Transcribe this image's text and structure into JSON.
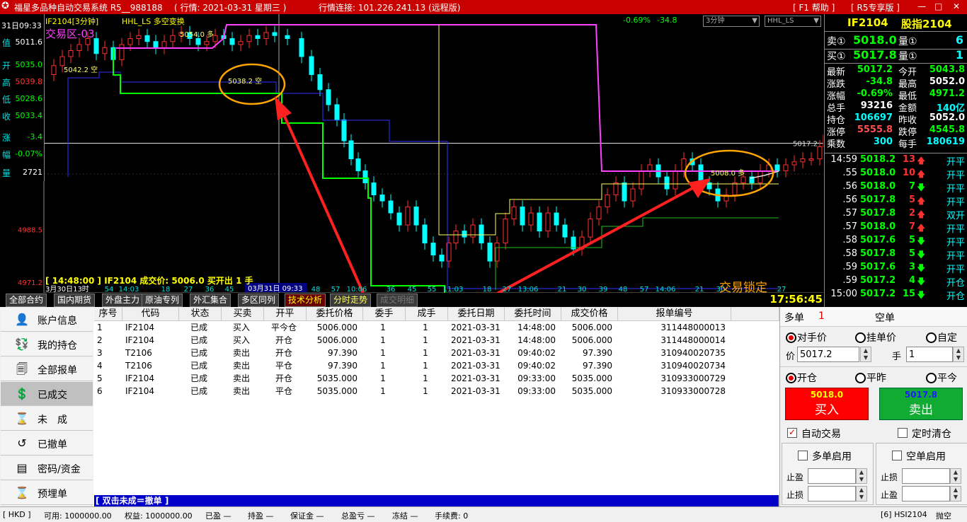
{
  "title_bar": {
    "app_title": "福星多品种自动交易系统 R5__988188",
    "market_info": "( 行情: 2021-03-31 星期三 )",
    "connection": "行情连接: 101.226.241.13 (远程版)",
    "help": "[ F1 帮助 ]",
    "edition": "[ R5专享版 ]"
  },
  "chart": {
    "header": "IF2104[3分钟]",
    "indicator": "HHL_LS 多空变换",
    "zone": "交易区-03",
    "change_pct": "-0.69%",
    "change_abs": "-34.8",
    "period_select": "3分钟",
    "indicator_select": "HHL_LS",
    "trade_info": "[ 14:48:00 ] IF2104 成交价: 5006.0 买开出 1 手",
    "lock_label": "交易锁定",
    "clock": "17:56:45",
    "price_labels": [
      "4988.5",
      "4971.2"
    ],
    "annotations": [
      "5054.0 多",
      "5042.2 空",
      "5038.2 空",
      "5008.0 多"
    ],
    "last_price_label": "5017.2",
    "x_start": "3月30日13时",
    "date_marker": "03月31日 09:33",
    "x_ticks": [
      "54",
      "14:03",
      "18",
      "27",
      "36",
      "45",
      "48",
      "57",
      "10:06",
      "36",
      "45",
      "55",
      "11:03",
      "18",
      "27",
      "13:06",
      "21",
      "30",
      "39",
      "48",
      "57",
      "14:06",
      "21",
      "30",
      "27"
    ],
    "colors": {
      "up": "#ff3030",
      "down": "#00ffff",
      "short_line": "#00ff00",
      "long_line": "#ff40ff",
      "highlight": "#ffa500",
      "arrow": "#ff2020"
    }
  },
  "left_info": {
    "date": "31日09:33",
    "rows": [
      {
        "k": "值",
        "v": "5011.6",
        "color": "#ffffff"
      },
      {
        "k": "开",
        "v": "5035.0",
        "color": "#00ff00"
      },
      {
        "k": "高",
        "v": "5039.8",
        "color": "#ff3030"
      },
      {
        "k": "低",
        "v": "5028.6",
        "color": "#00ff00"
      },
      {
        "k": "收",
        "v": "5033.4",
        "color": "#00ff00"
      },
      {
        "k": "涨",
        "v": "-3.4",
        "color": "#00ff00"
      },
      {
        "k": "幅",
        "v": "-0.07%",
        "color": "#00ff00"
      },
      {
        "k": "量",
        "v": "2721",
        "color": "#ffffff"
      }
    ]
  },
  "chart_tabs": [
    "全部合约",
    "国内期货",
    "外盘主力",
    "原油专列",
    "外汇集合",
    "多区同列",
    "技术分析",
    "分时走势",
    "成交明细"
  ],
  "quote": {
    "symbol": "IF2104",
    "name": "股指2104",
    "sell": {
      "label": "卖①",
      "price": "5018.0",
      "vol_label": "量①",
      "vol": "6"
    },
    "buy": {
      "label": "买①",
      "price": "5017.8",
      "vol_label": "量①",
      "vol": "1"
    },
    "stats": [
      [
        "最新",
        "5017.2",
        "今开",
        "5043.8"
      ],
      [
        "涨跌",
        "-34.8",
        "最高",
        "5052.0"
      ],
      [
        "涨幅",
        "-0.69%",
        "最低",
        "4971.2"
      ],
      [
        "总手",
        "93216",
        "金额",
        "140亿"
      ],
      [
        "持仓",
        "106697",
        "昨收",
        "5052.0"
      ],
      [
        "涨停",
        "5555.8",
        "跌停",
        "4545.8"
      ],
      [
        "乘数",
        "300",
        "每手",
        "180619"
      ]
    ],
    "ticks": [
      {
        "time": "14:59",
        "price": "5018.2",
        "vol": "13",
        "dir": "up",
        "type": "开平"
      },
      {
        "time": ".55",
        "price": "5018.0",
        "vol": "10",
        "dir": "up",
        "type": "开平"
      },
      {
        "time": ".56",
        "price": "5018.0",
        "vol": "7",
        "dir": "down",
        "type": "开平"
      },
      {
        "time": ".56",
        "price": "5017.8",
        "vol": "5",
        "dir": "up",
        "type": "开平"
      },
      {
        "time": ".57",
        "price": "5017.8",
        "vol": "2",
        "dir": "up",
        "type": "双开"
      },
      {
        "time": ".57",
        "price": "5018.0",
        "vol": "7",
        "dir": "up",
        "type": "开平"
      },
      {
        "time": ".58",
        "price": "5017.6",
        "vol": "5",
        "dir": "down",
        "type": "开平"
      },
      {
        "time": ".58",
        "price": "5017.8",
        "vol": "5",
        "dir": "down",
        "type": "开平"
      },
      {
        "time": ".59",
        "price": "5017.6",
        "vol": "3",
        "dir": "down",
        "type": "开平"
      },
      {
        "time": ".59",
        "price": "5017.2",
        "vol": "4",
        "dir": "down",
        "type": "开仓"
      },
      {
        "time": "15:00",
        "price": "5017.2",
        "vol": "15",
        "dir": "down",
        "type": "开仓"
      }
    ]
  },
  "sidebar": [
    {
      "label": "账户信息",
      "icon": "👤"
    },
    {
      "label": "我的持仓",
      "icon": "💱"
    },
    {
      "label": "全部报单",
      "icon": "🗐"
    },
    {
      "label": "已成交",
      "icon": "💲"
    },
    {
      "label": "未　成",
      "icon": "⌛"
    },
    {
      "label": "已撤单",
      "icon": "↺"
    },
    {
      "label": "密码/资金",
      "icon": "▤"
    },
    {
      "label": "预埋单",
      "icon": "⌛"
    }
  ],
  "table": {
    "headers": [
      "序号",
      "代码",
      "状态",
      "买卖",
      "开平",
      "委托价格",
      "委手",
      "成手",
      "委托日期",
      "委托时间",
      "成交价格",
      "报单编号"
    ],
    "rows": [
      [
        "1",
        "IF2104",
        "已成",
        "买入",
        "平今仓",
        "5006.000",
        "1",
        "1",
        "2021-03-31",
        "14:48:00",
        "5006.000",
        "311448000013"
      ],
      [
        "2",
        "IF2104",
        "已成",
        "买入",
        "开仓",
        "5006.000",
        "1",
        "1",
        "2021-03-31",
        "14:48:00",
        "5006.000",
        "311448000014"
      ],
      [
        "3",
        "T2106",
        "已成",
        "卖出",
        "开仓",
        "97.390",
        "1",
        "1",
        "2021-03-31",
        "09:40:02",
        "97.390",
        "310940020735"
      ],
      [
        "4",
        "T2106",
        "已成",
        "卖出",
        "平仓",
        "97.390",
        "1",
        "1",
        "2021-03-31",
        "09:40:02",
        "97.390",
        "310940020734"
      ],
      [
        "5",
        "IF2104",
        "已成",
        "卖出",
        "开仓",
        "5035.000",
        "1",
        "1",
        "2021-03-31",
        "09:33:00",
        "5035.000",
        "310933000729"
      ],
      [
        "6",
        "IF2104",
        "已成",
        "卖出",
        "平仓",
        "5035.000",
        "1",
        "1",
        "2021-03-31",
        "09:33:00",
        "5035.000",
        "310933000728"
      ]
    ]
  },
  "hint": "[ 双击未成＝撤单 ]",
  "order": {
    "long_label": "多单",
    "long_count": "1",
    "short_label": "空单",
    "price_modes": [
      "对手价",
      "挂单价",
      "自定"
    ],
    "price_label": "价",
    "price_value": "5017.2",
    "qty_label": "手",
    "qty_value": "1",
    "offset_modes": [
      "开仓",
      "平昨",
      "平今"
    ],
    "buy_price": "5018.0",
    "buy_label": "买入",
    "sell_price": "5017.8",
    "sell_label": "卖出",
    "auto_trade": "自动交易",
    "timed_clear": "定时清仓",
    "long_enable": "多单启用",
    "short_enable": "空单启用",
    "take_profit": "止盈",
    "stop_loss": "止损"
  },
  "status_bar": {
    "currency": "[ HKD ]",
    "available": "可用: 1000000.00",
    "equity": "权益: 1000000.00",
    "closed_pl": "已盈 —",
    "hold_pl": "持盈 —",
    "margin": "保证金 —",
    "total_pl": "总盈亏 —",
    "frozen": "冻结 —",
    "fee": "手续费: 0",
    "contract": "[6] HSI2104",
    "action": "抛空"
  }
}
